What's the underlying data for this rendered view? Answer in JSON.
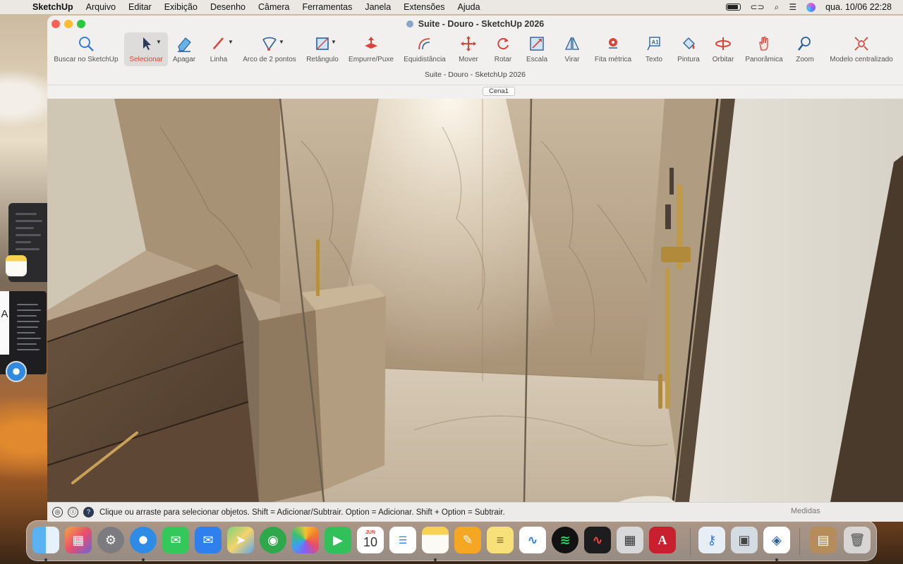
{
  "menubar": {
    "apple_icon": "apple-logo-icon",
    "app_name": "SketchUp",
    "items": [
      "Arquivo",
      "Editar",
      "Exibição",
      "Desenho",
      "Câmera",
      "Ferramentas",
      "Janela",
      "Extensões",
      "Ajuda"
    ],
    "datetime": "qua. 10/06  22:28"
  },
  "window": {
    "title": "Suite - Douro - SketchUp 2026",
    "doc_title": "Suite - Douro - SketchUp 2026",
    "scene_tab": "Cena1"
  },
  "toolbar": {
    "tools": [
      {
        "label": "Buscar no SketchUp",
        "icon": "search-icon"
      },
      {
        "label": "Selecionar",
        "icon": "select-arrow-icon",
        "selected": true
      },
      {
        "label": "Apagar",
        "icon": "eraser-icon"
      },
      {
        "label": "Linha",
        "icon": "pencil-line-icon"
      },
      {
        "label": "Arco de 2 pontos",
        "icon": "arc-icon"
      },
      {
        "label": "Retângulo",
        "icon": "rectangle-icon"
      },
      {
        "label": "Empurre/Puxe",
        "icon": "push-pull-icon"
      },
      {
        "label": "Equidistância",
        "icon": "offset-icon"
      },
      {
        "label": "Mover",
        "icon": "move-icon"
      },
      {
        "label": "Rotar",
        "icon": "rotate-icon"
      },
      {
        "label": "Escala",
        "icon": "scale-icon"
      },
      {
        "label": "Virar",
        "icon": "flip-icon"
      },
      {
        "label": "Fita métrica",
        "icon": "tape-measure-icon"
      },
      {
        "label": "Texto",
        "icon": "text-icon"
      },
      {
        "label": "Pintura",
        "icon": "paint-bucket-icon"
      },
      {
        "label": "Orbitar",
        "icon": "orbit-icon"
      },
      {
        "label": "Panorâmica",
        "icon": "pan-hand-icon"
      },
      {
        "label": "Zoom",
        "icon": "zoom-icon"
      },
      {
        "label": "Modelo centralizado",
        "icon": "zoom-extents-icon"
      }
    ]
  },
  "statusbar": {
    "message": "Clique ou arraste para selecionar objetos. Shift = Adicionar/Subtrair. Option = Adicionar. Shift + Option = Subtrair.",
    "measures_label": "Medidas"
  },
  "dock": {
    "apps": [
      "finder-icon",
      "launchpad-icon",
      "system-settings-icon",
      "safari-icon",
      "messages-icon",
      "mail-icon",
      "maps-icon",
      "find-my-icon",
      "photos-icon",
      "facetime-icon",
      "calendar-icon",
      "reminders-icon",
      "notes-icon",
      "pages-icon",
      "stickies-icon",
      "freeform-icon",
      "spotify-icon",
      "voice-memos-icon",
      "calculator-icon",
      "autocad-icon",
      "keychain-icon",
      "preview-icon",
      "sketchup-icon",
      "downloads-stack-icon",
      "trash-icon"
    ],
    "calendar_month": "JUN",
    "calendar_day": "10",
    "autocad_letter": "A"
  },
  "background": {
    "side_letter": "A"
  }
}
